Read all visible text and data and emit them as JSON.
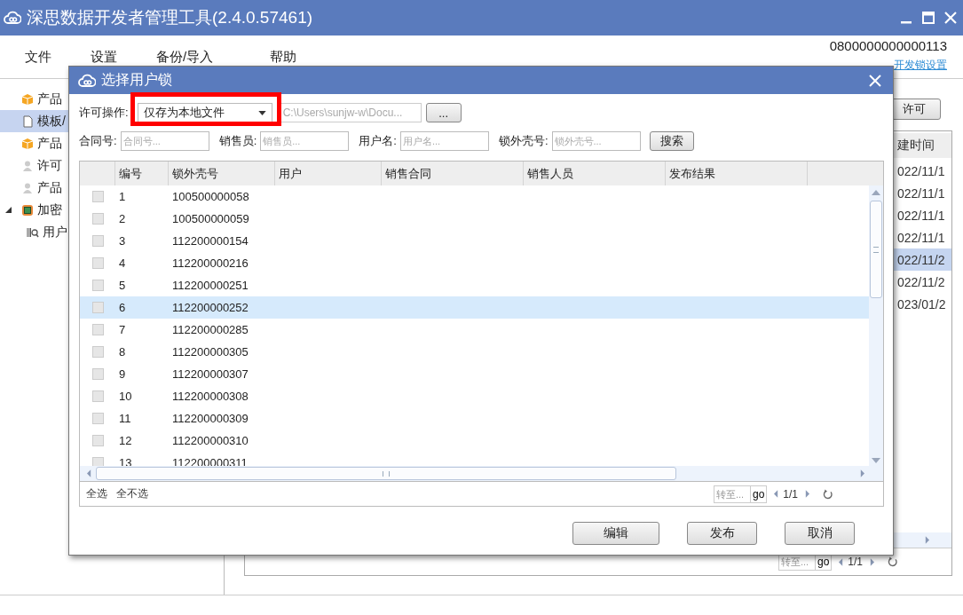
{
  "window": {
    "title": "深思数据开发者管理工具(2.4.0.57461)"
  },
  "menu": [
    "文件",
    "设置",
    "备份/导入",
    "帮助"
  ],
  "account": {
    "serial": "0800000000000113",
    "settings_link": "开发锁设置"
  },
  "sidebar": {
    "items": [
      {
        "label": "产品",
        "kind": "box",
        "selected": false
      },
      {
        "label": "模板/",
        "kind": "document",
        "selected": true
      },
      {
        "label": "产品",
        "kind": "box",
        "selected": false
      },
      {
        "label": "许可",
        "kind": "person",
        "selected": false
      },
      {
        "label": "产品",
        "kind": "person",
        "selected": false
      },
      {
        "label": "加密",
        "kind": "chip",
        "selected": false,
        "expanded": true,
        "children": [
          {
            "label": "用户",
            "kind": "scanner",
            "selected": false
          }
        ]
      }
    ]
  },
  "main_panel": {
    "button": "许可",
    "column_header": "建时间",
    "rows": [
      {
        "cell": "022/11/1",
        "selected": false
      },
      {
        "cell": "022/11/1",
        "selected": false
      },
      {
        "cell": "022/11/1",
        "selected": false
      },
      {
        "cell": "022/11/1",
        "selected": false
      },
      {
        "cell": "022/11/2",
        "selected": true
      },
      {
        "cell": "022/11/2",
        "selected": false
      },
      {
        "cell": "023/01/2",
        "selected": false
      }
    ],
    "pager": {
      "placeholder": "转至...",
      "go": "go",
      "page": "1/1"
    }
  },
  "dialog": {
    "title": "选择用户锁",
    "operation_label": "许可操作:",
    "operation_value": "仅存为本地文件",
    "highlighted": true,
    "path": {
      "value": "C:\\Users\\sunjw-w\\Docu...",
      "disabled": true
    },
    "browse": "...",
    "filters": [
      {
        "label": "合同号:",
        "placeholder": "合同号..."
      },
      {
        "label": "销售员:",
        "placeholder": "销售员..."
      },
      {
        "label": "用户名:",
        "placeholder": "用户名..."
      },
      {
        "label": "锁外壳号:",
        "placeholder": "锁外壳号..."
      }
    ],
    "search": "搜索",
    "columns": [
      "编号",
      "锁外壳号",
      "用户",
      "销售合同",
      "销售人员",
      "发布结果"
    ],
    "rows": [
      {
        "number": "1",
        "shell": "100500000058",
        "checked": false,
        "selected": false
      },
      {
        "number": "2",
        "shell": "100500000059",
        "checked": false,
        "selected": false
      },
      {
        "number": "3",
        "shell": "112200000154",
        "checked": false,
        "selected": false
      },
      {
        "number": "4",
        "shell": "112200000216",
        "checked": false,
        "selected": false
      },
      {
        "number": "5",
        "shell": "112200000251",
        "checked": false,
        "selected": false
      },
      {
        "number": "6",
        "shell": "112200000252",
        "checked": false,
        "selected": true
      },
      {
        "number": "7",
        "shell": "112200000285",
        "checked": false,
        "selected": false
      },
      {
        "number": "8",
        "shell": "112200000305",
        "checked": false,
        "selected": false
      },
      {
        "number": "9",
        "shell": "112200000307",
        "checked": false,
        "selected": false
      },
      {
        "number": "10",
        "shell": "112200000308",
        "checked": false,
        "selected": false
      },
      {
        "number": "11",
        "shell": "112200000309",
        "checked": false,
        "selected": false
      },
      {
        "number": "12",
        "shell": "112200000310",
        "checked": false,
        "selected": false
      },
      {
        "number": "13",
        "shell": "112200000311",
        "checked": false,
        "selected": false
      }
    ],
    "select_all": "全选",
    "select_none": "全不选",
    "pager": {
      "placeholder": "转至...",
      "go": "go",
      "page": "1/1"
    },
    "buttons": [
      "编辑",
      "发布",
      "取消"
    ]
  }
}
